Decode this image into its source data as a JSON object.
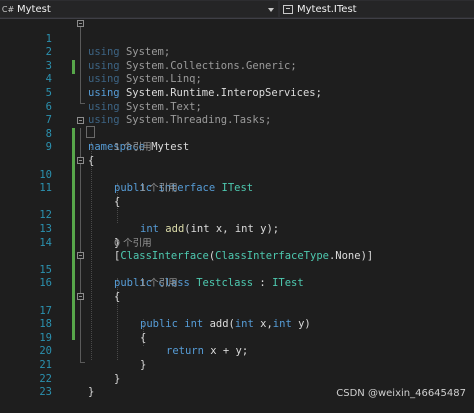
{
  "tabs": {
    "file": "Mytest",
    "member": "Mytest.ITest"
  },
  "lines": [
    {
      "n": "1"
    },
    {
      "n": "2"
    },
    {
      "n": "3"
    },
    {
      "n": "4"
    },
    {
      "n": "5"
    },
    {
      "n": "6"
    },
    {
      "n": "7"
    },
    {
      "n": "8"
    },
    {
      "n": "9"
    },
    {
      "n": "10"
    },
    {
      "n": "11"
    },
    {
      "n": "12"
    },
    {
      "n": "13"
    },
    {
      "n": "14"
    },
    {
      "n": "15"
    },
    {
      "n": "16"
    },
    {
      "n": "17"
    },
    {
      "n": "18"
    },
    {
      "n": "19"
    },
    {
      "n": "20"
    },
    {
      "n": "21"
    },
    {
      "n": "22"
    },
    {
      "n": "23"
    }
  ],
  "code": {
    "using_kw": "using",
    "u1": "System",
    "u2": "System.Collections.Generic",
    "u3": "System.Linq",
    "u4": "System.Runtime.InteropServices",
    "u5": "System.Text",
    "u6": "System.Threading.Tasks",
    "semi": ";",
    "ns_kw": "namespace",
    "ns_name": "Mytest",
    "open": "{",
    "close": "}",
    "public_kw": "public",
    "interface_kw": "interface",
    "itest": "ITest",
    "int_kw": "int",
    "add": "add",
    "params_iface": "(int x, int y);",
    "attr_open": "[",
    "attr_name": "ClassInterface",
    "attr_args_a": "(",
    "attr_type": "ClassInterfaceType",
    "attr_args_b": ".None)]",
    "class_kw": "class",
    "testclass": "Testclass",
    "colon": " : ",
    "params_impl_a": "(",
    "params_impl_b": " x,",
    "params_impl_c": " y)",
    "return_kw": "return",
    "return_expr": " x + y;"
  },
  "lens": {
    "ref_iface": "1 个引用",
    "ref_add": "1 个引用",
    "ref_class": "0 个引用",
    "ref_impl": "1 个引用"
  },
  "watermark": "CSDN @weixin_46645487"
}
